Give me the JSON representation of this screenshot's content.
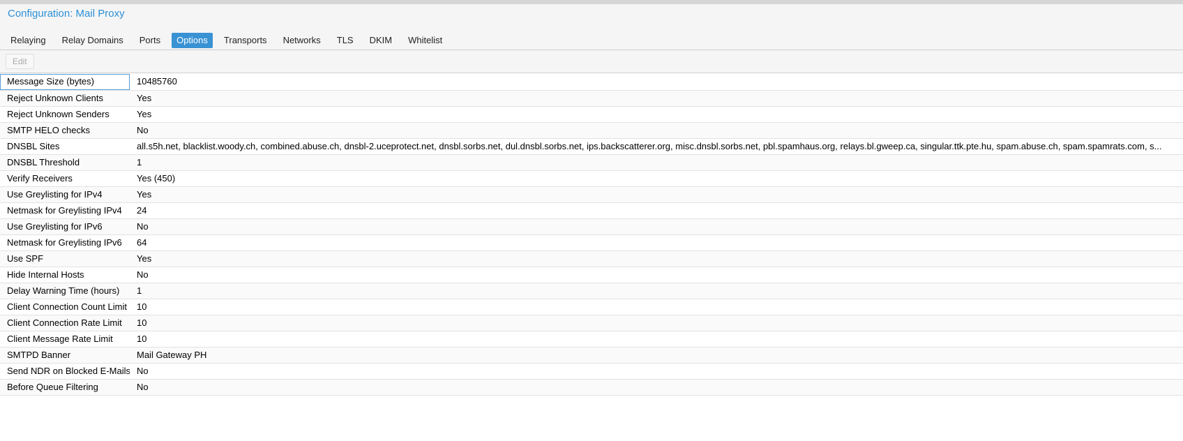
{
  "header": {
    "title": "Configuration: Mail Proxy"
  },
  "tabs": [
    {
      "label": "Relaying",
      "active": false
    },
    {
      "label": "Relay Domains",
      "active": false
    },
    {
      "label": "Ports",
      "active": false
    },
    {
      "label": "Options",
      "active": true
    },
    {
      "label": "Transports",
      "active": false
    },
    {
      "label": "Networks",
      "active": false
    },
    {
      "label": "TLS",
      "active": false
    },
    {
      "label": "DKIM",
      "active": false
    },
    {
      "label": "Whitelist",
      "active": false
    }
  ],
  "toolbar": {
    "edit_label": "Edit",
    "edit_disabled": true
  },
  "options": [
    {
      "name": "Message Size (bytes)",
      "value": "10485760"
    },
    {
      "name": "Reject Unknown Clients",
      "value": "Yes"
    },
    {
      "name": "Reject Unknown Senders",
      "value": "Yes"
    },
    {
      "name": "SMTP HELO checks",
      "value": "No"
    },
    {
      "name": "DNSBL Sites",
      "value": "all.s5h.net, blacklist.woody.ch, combined.abuse.ch, dnsbl-2.uceprotect.net, dnsbl.sorbs.net, dul.dnsbl.sorbs.net, ips.backscatterer.org, misc.dnsbl.sorbs.net, pbl.spamhaus.org, relays.bl.gweep.ca, singular.ttk.pte.hu, spam.abuse.ch, spam.spamrats.com, s..."
    },
    {
      "name": "DNSBL Threshold",
      "value": "1"
    },
    {
      "name": "Verify Receivers",
      "value": "Yes (450)"
    },
    {
      "name": "Use Greylisting for IPv4",
      "value": "Yes"
    },
    {
      "name": "Netmask for Greylisting IPv4",
      "value": "24"
    },
    {
      "name": "Use Greylisting for IPv6",
      "value": "No"
    },
    {
      "name": "Netmask for Greylisting IPv6",
      "value": "64"
    },
    {
      "name": "Use SPF",
      "value": "Yes"
    },
    {
      "name": "Hide Internal Hosts",
      "value": "No"
    },
    {
      "name": "Delay Warning Time (hours)",
      "value": "1"
    },
    {
      "name": "Client Connection Count Limit",
      "value": "10"
    },
    {
      "name": "Client Connection Rate Limit",
      "value": "10"
    },
    {
      "name": "Client Message Rate Limit",
      "value": "10"
    },
    {
      "name": "SMTPD Banner",
      "value": "Mail Gateway PH"
    },
    {
      "name": "Send NDR on Blocked E-Mails",
      "value": "No"
    },
    {
      "name": "Before Queue Filtering",
      "value": "No"
    }
  ]
}
